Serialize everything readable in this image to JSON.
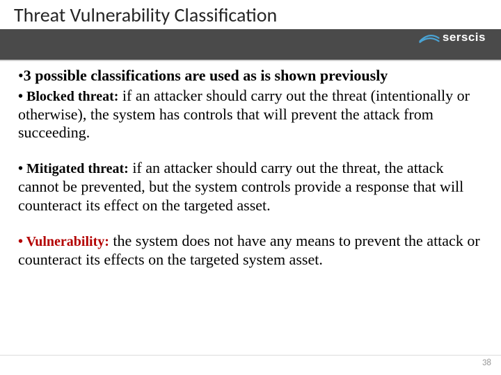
{
  "header": {
    "title": "Threat Vulnerability Classification",
    "logo_text": "serscis"
  },
  "content": {
    "intro_marker": "•",
    "intro": "3 possible classifications are used as is shown previously",
    "bullets": [
      {
        "label": "• Blocked threat:",
        "text": " if an attacker should carry out the threat (intentionally or otherwise), the system has controls that will prevent the attack from succeeding.",
        "red": false
      },
      {
        "label": "• Mitigated threat:",
        "text": " if an attacker should carry out the threat, the attack cannot be prevented, but the system controls provide a response that will counteract its effect on the targeted asset.",
        "red": false
      },
      {
        "label": "• Vulnerability:",
        "text": " the system does not have any means to prevent the attack or counteract its effects on the targeted system asset.",
        "red": true
      }
    ]
  },
  "page_number": "38"
}
